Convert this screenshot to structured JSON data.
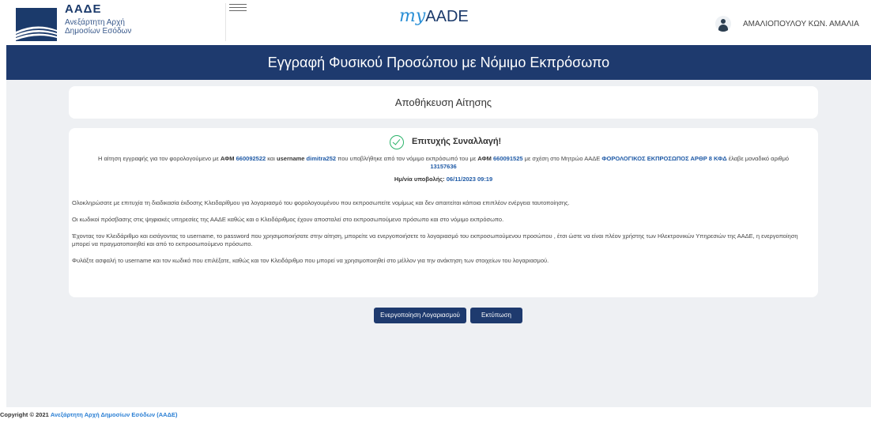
{
  "header": {
    "logo_acronym": "ΑΑΔΕ",
    "logo_line1": "Ανεξάρτητη Αρχή",
    "logo_line2": "Δημοσίων Εσόδων",
    "brand_my": "my",
    "brand_aade": "AADE",
    "user_name": "ΑΜΑΛΙΟΠΟΥΛΟΥ ΚΩΝ. ΑΜΑΛΙΑ"
  },
  "banner": {
    "title": "Εγγραφή Φυσικού Προσώπου με Νόμιμο Εκπρόσωπο"
  },
  "save": {
    "title": "Αποθήκευση Αίτησης"
  },
  "result": {
    "success_title": "Επιτυχής Συναλλαγή!",
    "msg_part1": "Η αίτηση εγγραφής για τον φορολογούμενο με ",
    "afm_label1": "ΑΦΜ",
    "afm1": "660092522",
    "msg_part2": " και ",
    "username_label": "username",
    "username": "dimitra252",
    "msg_part3": " που υποβλήθηκε από τον νόμιμο εκπρόσωπό του με ",
    "afm_label2": "ΑΦΜ",
    "afm2": "660091525",
    "msg_part4": " με σχέση στο Μητρώο ΑΑΔΕ ",
    "relation": "ΦΟΡΟΛΟΓΙΚΟΣ ΕΚΠΡΟΣΩΠΟΣ ΑΡΘΡ 8 ΚΦΔ",
    "msg_part5": " έλαβε μοναδικό αριθμό ",
    "unique_no": "13157636",
    "date_label": "Ημ/νία υποβολής:",
    "date_value": "06/11/2023 09:19"
  },
  "paragraphs": [
    "Ολοκληρώσατε με επιτυχία τη διαδικασία έκδοσης Κλειδαρίθμου για λογαριασμό του φορολογουμένου που εκπροσωπείτε νομίμως και δεν απαιτείται κάποια επιπλέον ενέργεια ταυτοποίησης.",
    "Οι κωδικοί πρόσβασης στις ψηφιακές υπηρεσίες της ΑΑΔΕ καθώς και ο Κλειδάριθμος έχουν αποσταλεί στο εκπροσωπούμενο πρόσωπο και στο νόμιμο εκπρόσωπο.",
    "Έχοντας τον Κλειδάριθμο και εισάγοντας το username, το password που χρησιμοποιήσατε στην αίτηση, μπορείτε να ενεργοποιήσετε το λογαριασμό του εκπροσωπούμενου προσώπου , έτσι ώστε να είναι πλέον χρήστης των Ηλεκτρονικών Υπηρεσιών της ΑΑΔΕ, η ενεργοποίηση μπορεί να πραγματοποιηθεί και από το εκπροσωπούμενο πρόσωπο.",
    "Φυλάξτε ασφαλή το username και τον κωδικό που επιλέξατε, καθώς και τον Κλειδάριθμο που μπορεί να χρησιμοποιηθεί στο μέλλον για την ανάκτηση των στοιχείων του λογαριασμού."
  ],
  "buttons": {
    "activate": "Ενεργοποίηση Λογαριασμού",
    "print": "Εκτύπωση"
  },
  "footer": {
    "copyright": "Copyright © 2021 ",
    "org_link": "Ανεξάρτητη Αρχή Δημοσίων Εσόδων (ΑΑΔΕ)"
  },
  "colors": {
    "primary_navy": "#1e3a6e",
    "success_green": "#2bb36a",
    "link_blue": "#2a7fd4"
  }
}
